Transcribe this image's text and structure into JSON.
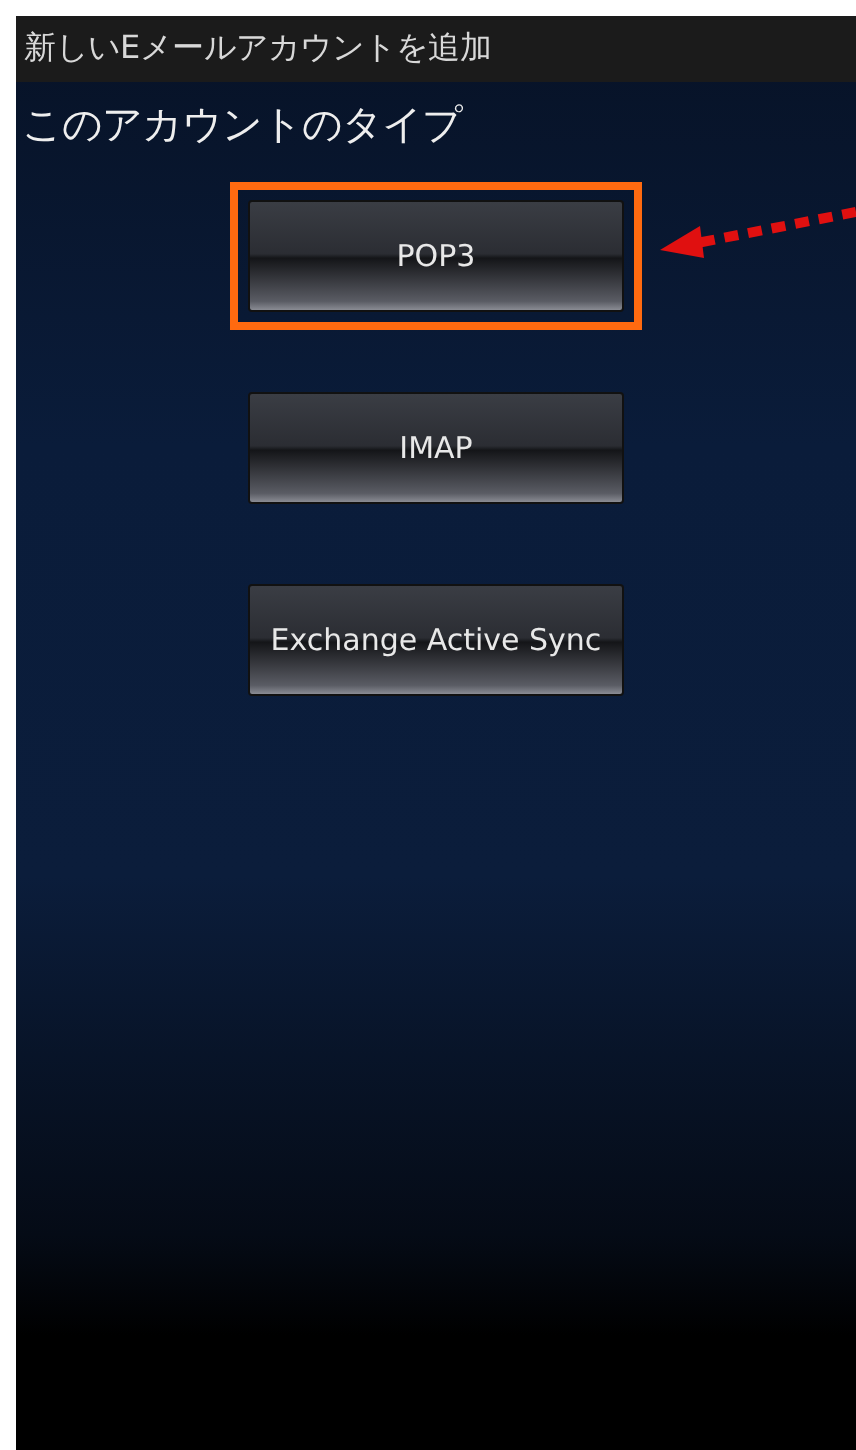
{
  "window": {
    "title": "新しいEメールアカウントを追加"
  },
  "heading": "このアカウントのタイプ",
  "buttons": [
    {
      "label": "POP3",
      "highlighted": true
    },
    {
      "label": "IMAP",
      "highlighted": false
    },
    {
      "label": "Exchange Active Sync",
      "highlighted": false
    }
  ]
}
